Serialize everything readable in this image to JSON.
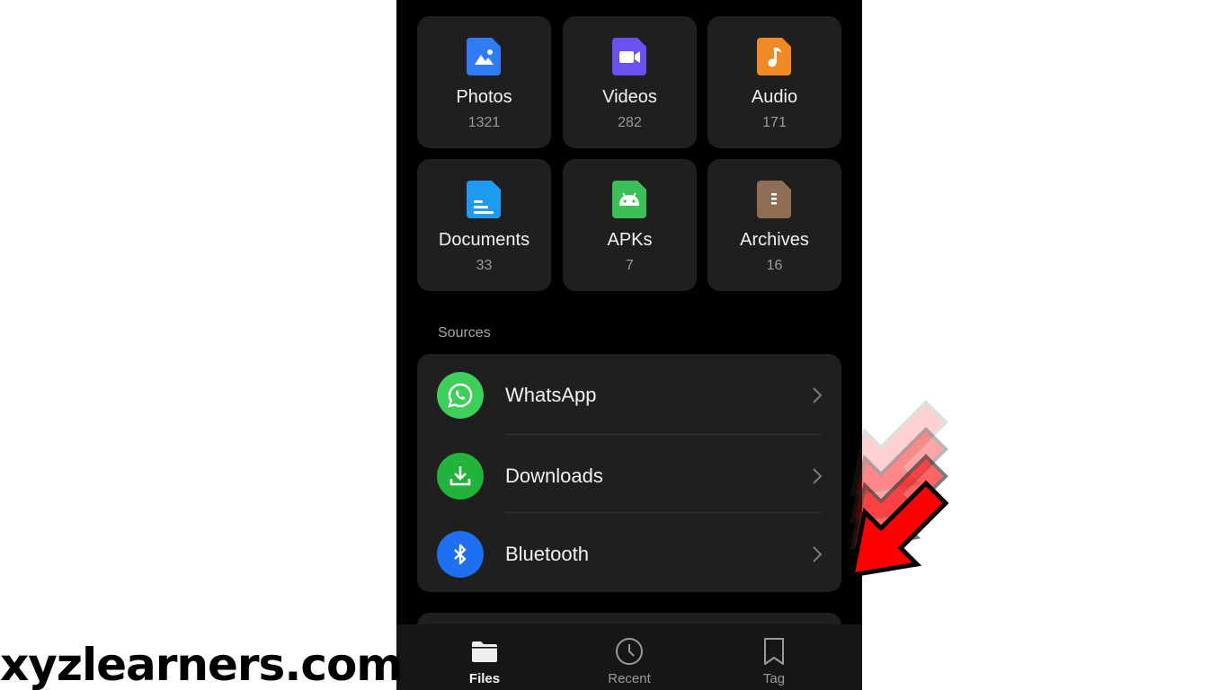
{
  "categories": [
    {
      "label": "Photos",
      "count": "1321",
      "icon": "image-icon",
      "color": "#2f7cf6"
    },
    {
      "label": "Videos",
      "count": "282",
      "icon": "video-icon",
      "color": "#6b52f0"
    },
    {
      "label": "Audio",
      "count": "171",
      "icon": "music-icon",
      "color": "#f08a24"
    },
    {
      "label": "Documents",
      "count": "33",
      "icon": "document-icon",
      "color": "#1e9bf0"
    },
    {
      "label": "APKs",
      "count": "7",
      "icon": "android-icon",
      "color": "#3bbf57"
    },
    {
      "label": "Archives",
      "count": "16",
      "icon": "archive-icon",
      "color": "#8e6e55"
    }
  ],
  "sources": {
    "heading": "Sources",
    "items": [
      {
        "label": "WhatsApp",
        "icon": "whatsapp-icon",
        "color": "#3ecf5b"
      },
      {
        "label": "Downloads",
        "icon": "download-icon",
        "color": "#22b33a"
      },
      {
        "label": "Bluetooth",
        "icon": "bluetooth-icon",
        "color": "#1f6ff2"
      }
    ]
  },
  "navbar": {
    "items": [
      {
        "label": "Files",
        "icon": "folder-icon",
        "active": true
      },
      {
        "label": "Recent",
        "icon": "clock-icon",
        "active": false
      },
      {
        "label": "Tag",
        "icon": "bookmark-icon",
        "active": false
      }
    ]
  },
  "watermark": "xyzlearners.com",
  "colors": {
    "background": "#000000",
    "card": "#1f1f1f",
    "arrow": "#ff0000"
  }
}
